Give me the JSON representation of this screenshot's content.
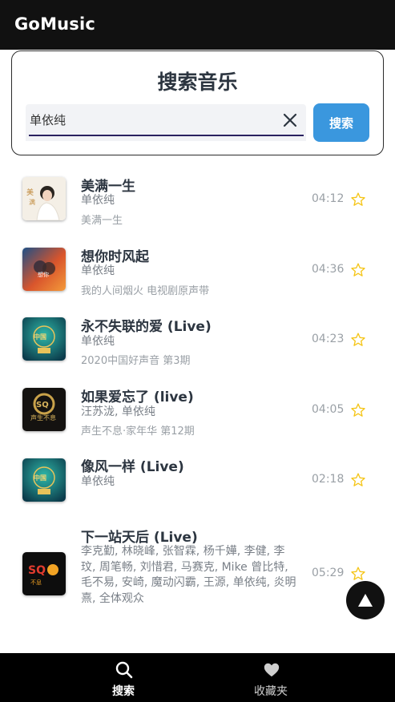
{
  "app": {
    "title": "GoMusic"
  },
  "search": {
    "heading": "搜索音乐",
    "value": "单依纯",
    "button_label": "搜索"
  },
  "results": [
    {
      "title": "美满一生",
      "artist": "单依纯",
      "album": "美满一生",
      "duration": "04:12"
    },
    {
      "title": "想你时风起",
      "artist": "单依纯",
      "album": "我的人间烟火 电视剧原声带",
      "duration": "04:36"
    },
    {
      "title": "永不失联的爱 (Live)",
      "artist": "单依纯",
      "album": "2020中国好声音 第3期",
      "duration": "04:23"
    },
    {
      "title": "如果爱忘了 (live)",
      "artist": "汪苏泷, 单依纯",
      "album": "声生不息·家年华 第12期",
      "duration": "04:05"
    },
    {
      "title": "像风一样 (Live)",
      "artist": "单依纯",
      "album": "",
      "duration": "02:18"
    },
    {
      "title": "下一站天后 (Live)",
      "artist": "李克勤, 林晓峰, 张智霖, 杨千嬅, 李健, 李玟, 周笔畅, 刘惜君, 马赛克, Mike 曾比特, 毛不易, 安崎, 魔动闪霸, 王源, 单依纯, 炎明熹, 全体观众",
      "album": "",
      "duration": "05:29"
    }
  ],
  "nav": {
    "items": [
      {
        "label": "搜索",
        "icon": "search-icon",
        "active": true
      },
      {
        "label": "收藏夹",
        "icon": "heart-icon",
        "active": false
      }
    ]
  },
  "colors": {
    "appbar": "#111111",
    "accent_button": "#3a97de",
    "star": "#f5c518",
    "nav_active": "#ffffff",
    "nav_inactive": "#cfcfcf"
  }
}
